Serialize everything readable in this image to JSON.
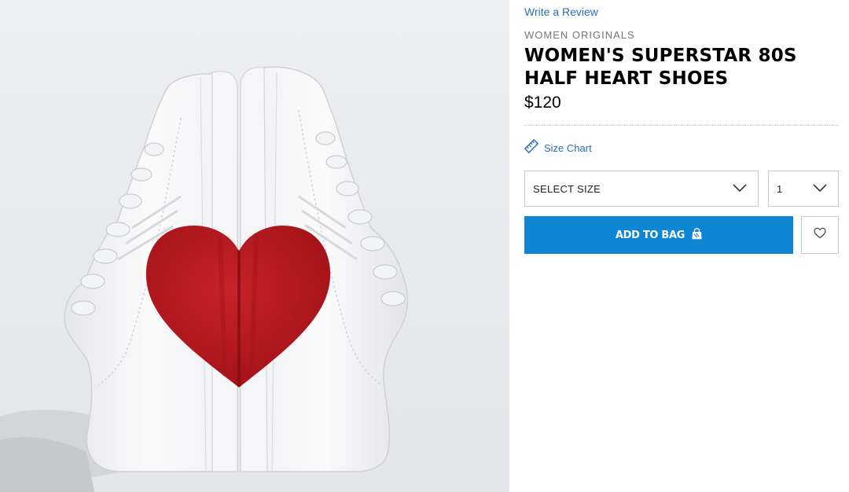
{
  "product": {
    "review_link": "Write a Review",
    "category": "WOMEN ORIGINALS",
    "title": "WOMEN'S SUPERSTAR 80S HALF HEART SHOES",
    "price": "$120"
  },
  "size_chart": {
    "label": "Size Chart",
    "icon": "ruler-icon"
  },
  "selectors": {
    "size": {
      "label": "SELECT SIZE",
      "icon": "chevron-down-icon"
    },
    "quantity": {
      "value": "1",
      "icon": "chevron-down-icon"
    }
  },
  "actions": {
    "add_to_bag": {
      "label": "ADD TO BAG",
      "icon": "shopping-bag-icon"
    },
    "wishlist": {
      "icon": "heart-icon"
    }
  },
  "colors": {
    "accent_blue": "#0f86d3",
    "link_blue": "#2a6ebb",
    "image_background": "#eceef0",
    "heart_red": "#b5161d"
  }
}
